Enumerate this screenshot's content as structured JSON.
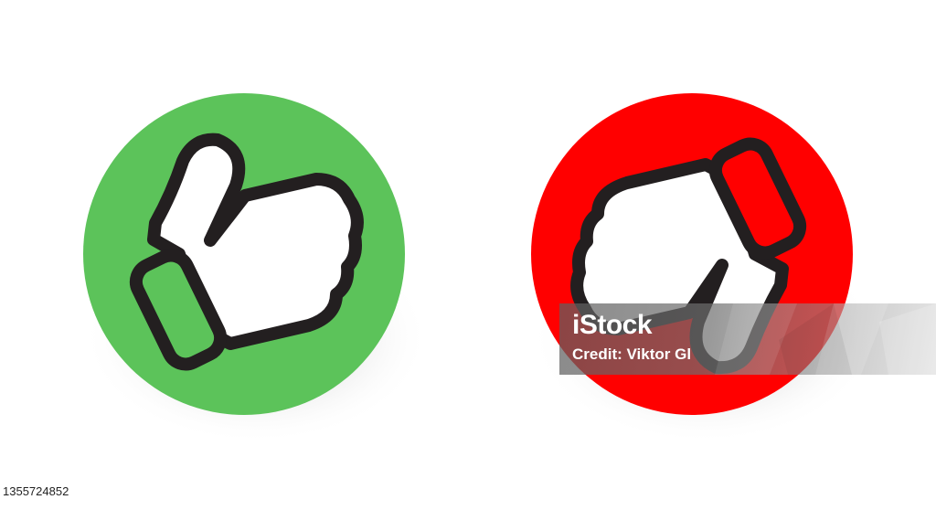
{
  "watermark": {
    "logo": "iStock",
    "credit": "Credit: Viktor Gl"
  },
  "image_id": "1355724852",
  "icons": [
    {
      "name": "thumbs-up-icon",
      "circle_color": "#5cc35a"
    },
    {
      "name": "thumbs-down-icon",
      "circle_color": "#ff0000"
    }
  ],
  "colors": {
    "outline": "#231f20",
    "hand_fill": "#ffffff",
    "shadow": "#d9d9d9"
  }
}
